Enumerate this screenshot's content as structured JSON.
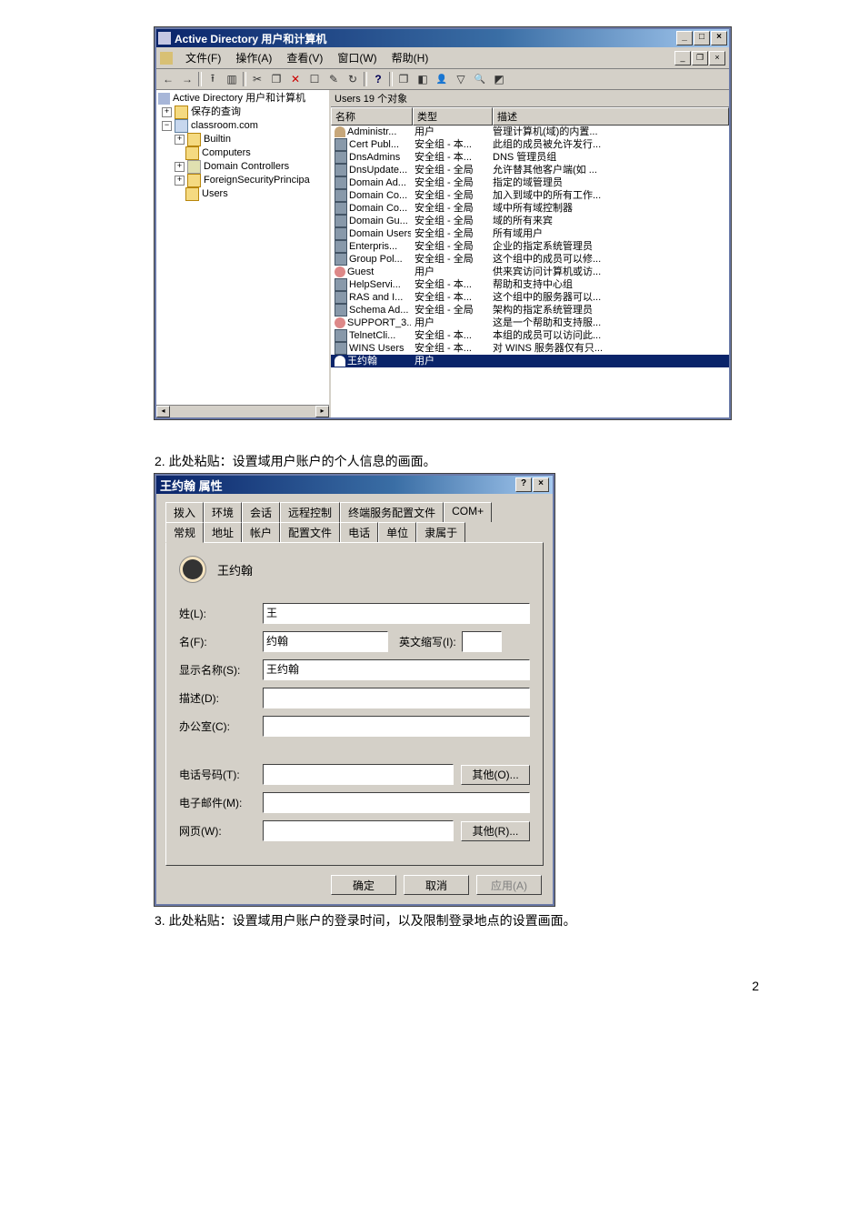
{
  "step2_text": "2. 此处粘贴：设置域用户账户的个人信息的画面。",
  "step3_text": "3. 此处粘贴：设置域用户账户的登录时间，以及限制登录地点的设置画面。",
  "page_number": "2",
  "ad_window": {
    "title": "Active Directory 用户和计算机",
    "menus": {
      "file": "文件(F)",
      "action": "操作(A)",
      "view": "查看(V)",
      "window": "窗口(W)",
      "help": "帮助(H)"
    },
    "tree": {
      "root": "Active Directory 用户和计算机",
      "saved_queries": "保存的查询",
      "domain": "classroom.com",
      "nodes": {
        "builtin": "Builtin",
        "computers": "Computers",
        "dc": "Domain Controllers",
        "fsp": "ForeignSecurityPrincipa",
        "users": "Users"
      }
    },
    "list": {
      "header": "Users   19 个对象",
      "cols": {
        "name": "名称",
        "type": "类型",
        "desc": "描述"
      },
      "rows": [
        {
          "icon": "user",
          "name": "Administr...",
          "type": "用户",
          "desc": "管理计算机(域)的内置..."
        },
        {
          "icon": "grp",
          "name": "Cert Publ...",
          "type": "安全组 - 本...",
          "desc": "此组的成员被允许发行..."
        },
        {
          "icon": "grp",
          "name": "DnsAdmins",
          "type": "安全组 - 本...",
          "desc": "DNS 管理员组"
        },
        {
          "icon": "grp",
          "name": "DnsUpdate...",
          "type": "安全组 - 全局",
          "desc": "允许替其他客户端(如 ..."
        },
        {
          "icon": "grp",
          "name": "Domain Ad...",
          "type": "安全组 - 全局",
          "desc": "指定的域管理员"
        },
        {
          "icon": "grp",
          "name": "Domain Co...",
          "type": "安全组 - 全局",
          "desc": "加入到域中的所有工作..."
        },
        {
          "icon": "grp",
          "name": "Domain Co...",
          "type": "安全组 - 全局",
          "desc": "域中所有域控制器"
        },
        {
          "icon": "grp",
          "name": "Domain Gu...",
          "type": "安全组 - 全局",
          "desc": "域的所有来宾"
        },
        {
          "icon": "grp",
          "name": "Domain Users",
          "type": "安全组 - 全局",
          "desc": "所有域用户"
        },
        {
          "icon": "grp",
          "name": "Enterpris...",
          "type": "安全组 - 全局",
          "desc": "企业的指定系统管理员"
        },
        {
          "icon": "grp",
          "name": "Group Pol...",
          "type": "安全组 - 全局",
          "desc": "这个组中的成员可以修..."
        },
        {
          "icon": "dis",
          "name": "Guest",
          "type": "用户",
          "desc": "供来宾访问计算机或访..."
        },
        {
          "icon": "grp",
          "name": "HelpServi...",
          "type": "安全组 - 本...",
          "desc": "帮助和支持中心组"
        },
        {
          "icon": "grp",
          "name": "RAS and I...",
          "type": "安全组 - 本...",
          "desc": "这个组中的服务器可以..."
        },
        {
          "icon": "grp",
          "name": "Schema Ad...",
          "type": "安全组 - 全局",
          "desc": "架构的指定系统管理员"
        },
        {
          "icon": "dis",
          "name": "SUPPORT_3...",
          "type": "用户",
          "desc": "这是一个帮助和支持服..."
        },
        {
          "icon": "grp",
          "name": "TelnetCli...",
          "type": "安全组 - 本...",
          "desc": "本组的成员可以访问此..."
        },
        {
          "icon": "grp",
          "name": "WINS Users",
          "type": "安全组 - 本...",
          "desc": "对 WINS 服务器仅有只..."
        },
        {
          "icon": "user",
          "name": "王约翰",
          "type": "用户",
          "desc": "",
          "selected": true
        }
      ]
    }
  },
  "prop_dialog": {
    "title": "王约翰 属性",
    "tabs_back": [
      "拨入",
      "环境",
      "会话",
      "远程控制",
      "终端服务配置文件",
      "COM+"
    ],
    "tabs_front": [
      "常规",
      "地址",
      "帐户",
      "配置文件",
      "电话",
      "单位",
      "隶属于"
    ],
    "active_tab": "常规",
    "display_user": "王约翰",
    "fields": {
      "last_name_label": "姓(L):",
      "last_name_value": "王",
      "first_name_label": "名(F):",
      "first_name_value": "约翰",
      "initials_label": "英文缩写(I):",
      "initials_value": "",
      "display_name_label": "显示名称(S):",
      "display_name_value": "王约翰",
      "description_label": "描述(D):",
      "description_value": "",
      "office_label": "办公室(C):",
      "office_value": "",
      "phone_label": "电话号码(T):",
      "phone_value": "",
      "phone_other_btn": "其他(O)...",
      "email_label": "电子邮件(M):",
      "email_value": "",
      "web_label": "网页(W):",
      "web_value": "",
      "web_other_btn": "其他(R)..."
    },
    "buttons": {
      "ok": "确定",
      "cancel": "取消",
      "apply": "应用(A)"
    }
  }
}
